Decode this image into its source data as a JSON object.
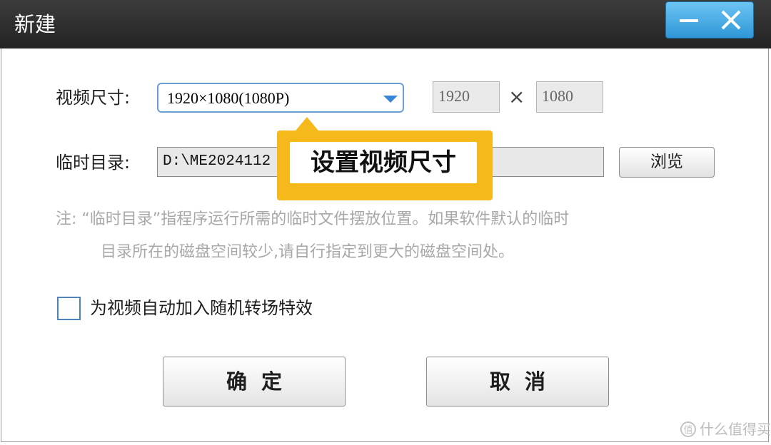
{
  "window": {
    "title": "新建",
    "minimize_icon": "minimize-icon",
    "close_icon": "close-icon"
  },
  "video_size": {
    "label": "视频尺寸:",
    "selected": "1920×1080(1080P)",
    "width": "1920",
    "times": "×",
    "height": "1080"
  },
  "temp_dir": {
    "label": "临时目录:",
    "value": "D:\\ME2024112",
    "browse_label": "浏览"
  },
  "note": {
    "line1": "注: “临时目录”指程序运行所需的临时文件摆放位置。如果软件默认的临时",
    "line2": "目录所在的磁盘空间较少,请自行指定到更大的磁盘空间处。"
  },
  "transition": {
    "label": "为视频自动加入随机转场特效",
    "checked": false
  },
  "buttons": {
    "ok": "确定",
    "cancel": "取消"
  },
  "callout": {
    "text": "设置视频尺寸",
    "color": "#f5b91c"
  },
  "watermark": {
    "text": "什么值得买",
    "icon": "zhi-logo-icon"
  },
  "colors": {
    "titlebar": "#2c2c2c",
    "window_controls": "#3aa0de",
    "dropdown_border": "#6a9fd3"
  }
}
